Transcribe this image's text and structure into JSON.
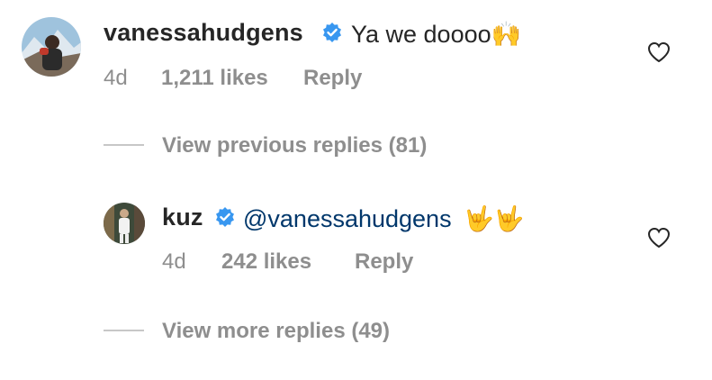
{
  "comment1": {
    "username": "vanessahudgens",
    "verified_icon": "verified-badge-icon",
    "text": "Ya we doooo",
    "emoji": "🙌",
    "age": "4d",
    "likes": "1,211 likes",
    "reply_label": "Reply"
  },
  "view_previous": "View previous replies (81)",
  "comment2": {
    "username": "kuz",
    "verified_icon": "verified-badge-icon",
    "mention": "@vanessahudgens",
    "emoji": "🤟🤟",
    "age": "4d",
    "likes": "242 likes",
    "reply_label": "Reply"
  },
  "view_more": "View more replies (49)",
  "colors": {
    "text": "#262626",
    "secondary": "#8e8e8e",
    "mention": "#00376b",
    "verified": "#3897f0"
  }
}
